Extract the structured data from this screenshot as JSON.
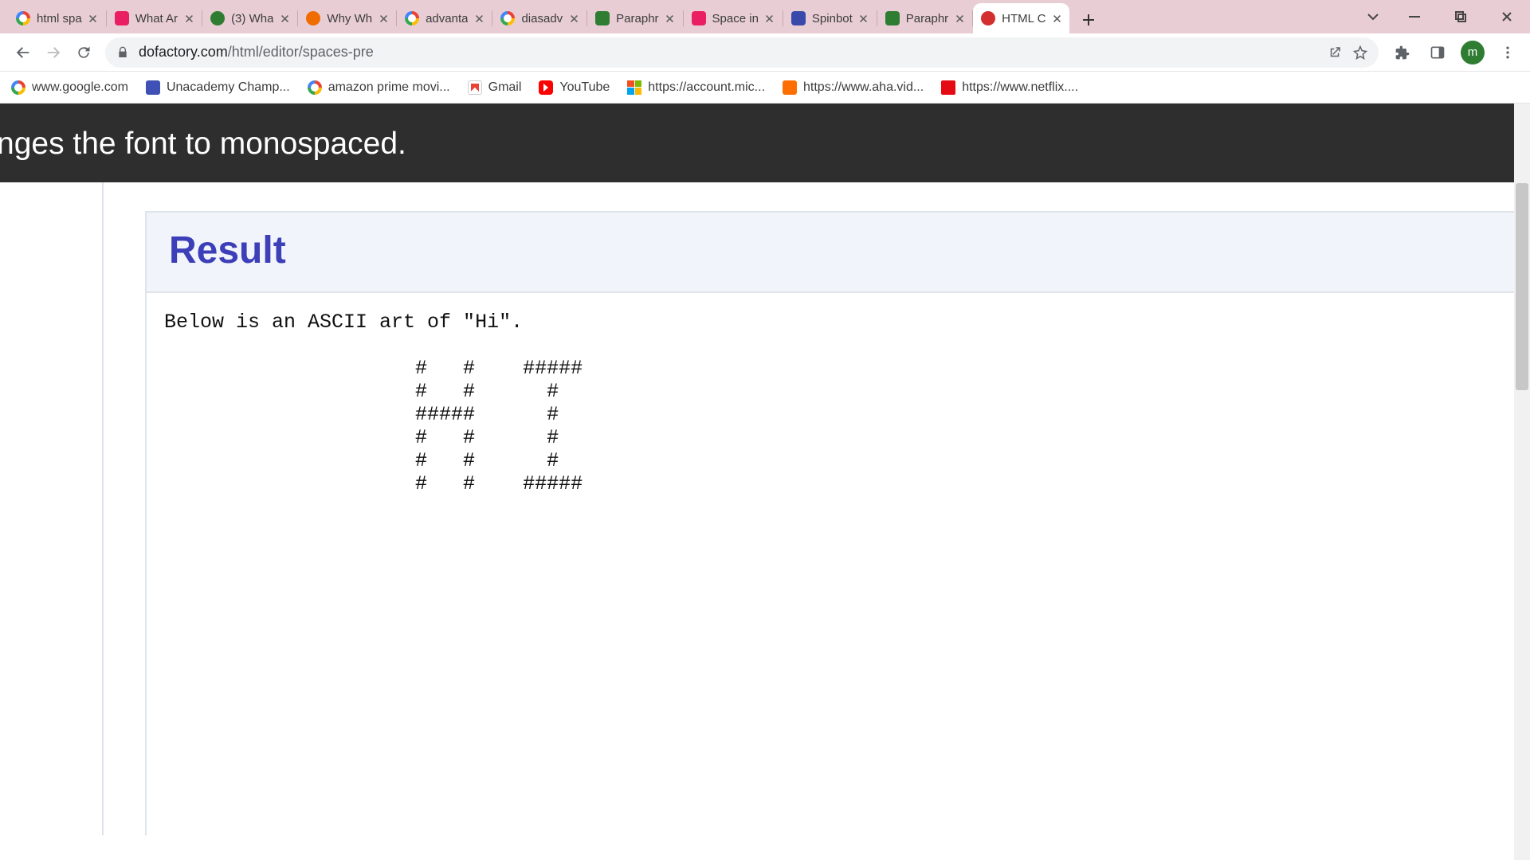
{
  "tabs": [
    {
      "label": "html spa",
      "favicon": "google"
    },
    {
      "label": "What Ar",
      "favicon": "quill-pink"
    },
    {
      "label": "(3) Wha",
      "favicon": "green-circ"
    },
    {
      "label": "Why Wh",
      "favicon": "orange-circ"
    },
    {
      "label": "advanta",
      "favicon": "google"
    },
    {
      "label": "diasadv",
      "favicon": "google"
    },
    {
      "label": "Paraphr",
      "favicon": "quill-green"
    },
    {
      "label": "Space in",
      "favicon": "quill-pink"
    },
    {
      "label": "Spinbot",
      "favicon": "spin"
    },
    {
      "label": "Paraphr",
      "favicon": "quill-green"
    },
    {
      "label": "HTML C",
      "favicon": "do",
      "active": true
    }
  ],
  "address": {
    "host": "dofactory.com",
    "path": "/html/editor/spaces-pre"
  },
  "bookmarks": [
    {
      "label": "www.google.com",
      "favicon": "google"
    },
    {
      "label": "Unacademy Champ...",
      "favicon": "un"
    },
    {
      "label": "amazon prime movi...",
      "favicon": "google"
    },
    {
      "label": "Gmail",
      "favicon": "gmail"
    },
    {
      "label": "YouTube",
      "favicon": "yt"
    },
    {
      "label": "https://account.mic...",
      "favicon": "ms"
    },
    {
      "label": "https://www.aha.vid...",
      "favicon": "aha"
    },
    {
      "label": "https://www.netflix....",
      "favicon": "nf"
    }
  ],
  "page": {
    "dark_strip_text": "nges the font to monospaced.",
    "result_heading": "Result",
    "pre_text": "Below is an ASCII art of \"Hi\".\n\n                     #   #    #####\n                     #   #      #\n                     #####      #\n                     #   #      #\n                     #   #      #\n                     #   #    #####"
  },
  "avatar_initial": "m"
}
